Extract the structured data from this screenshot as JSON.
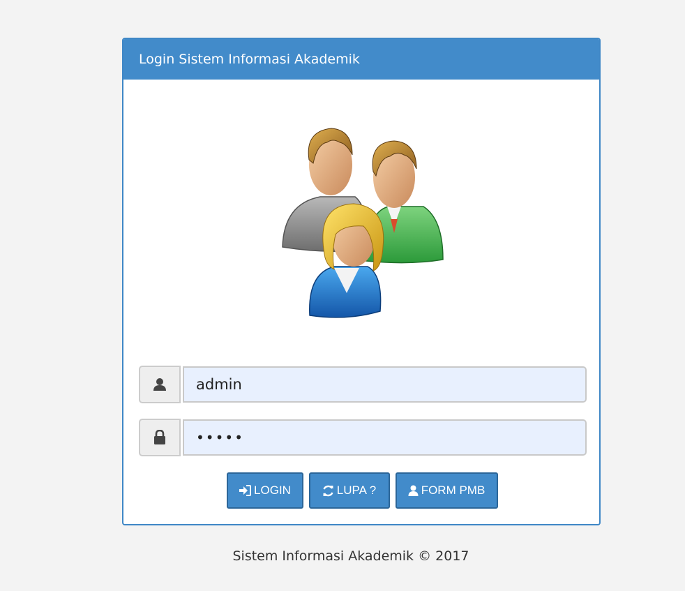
{
  "panel": {
    "title": "Login Sistem Informasi Akademik"
  },
  "form": {
    "username": {
      "value": "admin",
      "icon": "user-icon"
    },
    "password": {
      "value": "•••••",
      "icon": "lock-icon"
    }
  },
  "buttons": {
    "login": {
      "label": "LOGIN",
      "icon": "sign-in-icon"
    },
    "lupa": {
      "label": "LUPA ?",
      "icon": "refresh-icon"
    },
    "pmb": {
      "label": "FORM PMB",
      "icon": "user-icon"
    }
  },
  "footer": {
    "text": "Sistem Informasi Akademik © 2017"
  },
  "colors": {
    "primary": "#428bca",
    "background": "#f3f3f3",
    "field_bg": "#e8f0fe"
  }
}
